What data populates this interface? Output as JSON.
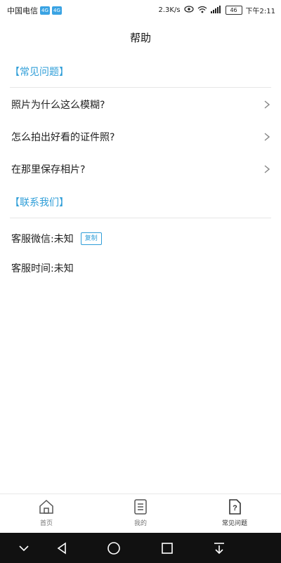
{
  "status_bar": {
    "carrier": "中国电信",
    "sim1": "4G",
    "sim2": "4G",
    "speed": "2.3K/s",
    "battery": "46",
    "time": "下午2:11"
  },
  "header": {
    "title": "帮助"
  },
  "faq": {
    "heading": "【常见问题】",
    "items": [
      {
        "label": "照片为什么这么模糊?"
      },
      {
        "label": "怎么拍出好看的证件照?"
      },
      {
        "label": "在那里保存相片?"
      }
    ]
  },
  "contact": {
    "heading": "【联系我们】",
    "wechat_label": "客服微信:未知",
    "copy_label": "复制",
    "hours_label": "客服时间:未知"
  },
  "tabs": [
    {
      "label": "首页",
      "icon": "home-icon"
    },
    {
      "label": "我的",
      "icon": "document-icon"
    },
    {
      "label": "常见问题",
      "icon": "question-doc-icon"
    }
  ],
  "colors": {
    "accent": "#2f9ed8",
    "nav_bg": "#111111"
  }
}
